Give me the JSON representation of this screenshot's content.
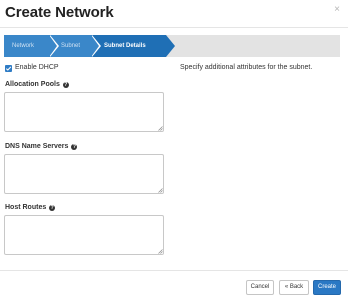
{
  "dialog": {
    "title": "Create Network",
    "close_glyph": "×"
  },
  "wizard": {
    "steps": [
      {
        "label": "Network",
        "state": "complete"
      },
      {
        "label": "Subnet",
        "state": "complete"
      },
      {
        "label": "Subnet Details",
        "state": "active"
      }
    ]
  },
  "form": {
    "enable_dhcp": {
      "label": "Enable DHCP",
      "checked": true
    },
    "help_text": "Specify additional attributes for the subnet.",
    "fields": [
      {
        "label": "Allocation Pools",
        "value": ""
      },
      {
        "label": "DNS Name Servers",
        "value": ""
      },
      {
        "label": "Host Routes",
        "value": ""
      }
    ],
    "help_icon": "?"
  },
  "footer": {
    "cancel_label": "Cancel",
    "back_label": "« Back",
    "create_label": "Create"
  },
  "colors": {
    "accent": "#2a78c4",
    "step_active": "#1f6fb5",
    "step_complete": "#3a87c9",
    "step_track": "#e3e3e3"
  }
}
